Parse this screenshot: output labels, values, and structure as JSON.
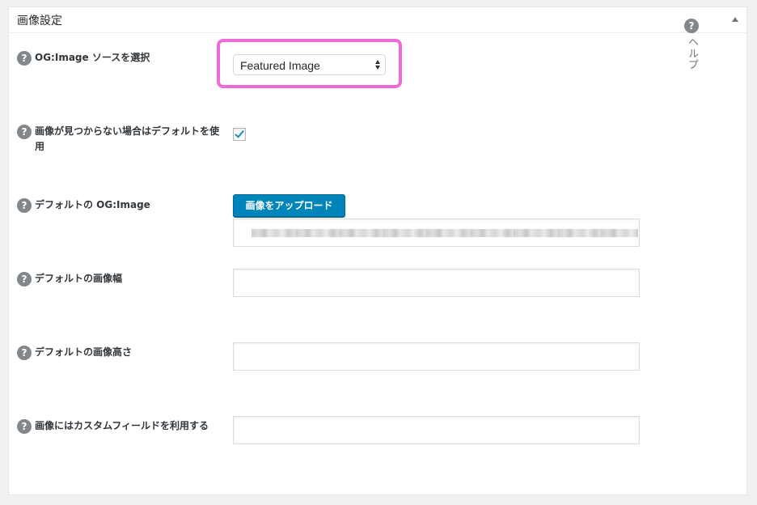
{
  "panel": {
    "title": "画像設定",
    "help_label": "ヘルプ",
    "help_icon": "?"
  },
  "rows": [
    {
      "label": "OG:Image ソースを選択",
      "help_icon": "?",
      "control": "select",
      "value": "Featured Image"
    },
    {
      "label": "画像が見つからない場合はデフォルトを使用",
      "help_icon": "?",
      "control": "checkbox",
      "checked": true
    },
    {
      "label": "デフォルトの OG:Image",
      "help_icon": "?",
      "control": "upload",
      "button_label": "画像をアップロード",
      "value_obscured": true
    },
    {
      "label": "デフォルトの画像幅",
      "help_icon": "?",
      "control": "text",
      "value": ""
    },
    {
      "label": "デフォルトの画像高さ",
      "help_icon": "?",
      "control": "text",
      "value": ""
    },
    {
      "label": "画像にはカスタムフィールドを利用する",
      "help_icon": "?",
      "control": "text",
      "value": ""
    }
  ],
  "colors": {
    "highlight": "#f06ad8",
    "primary_button": "#0085ba",
    "checkmark": "#1e8cbe"
  },
  "icons": {
    "help": "question-circle-icon",
    "collapse": "triangle-up-icon",
    "select_arrows": "updown-arrows-icon",
    "check": "checkmark-icon"
  }
}
